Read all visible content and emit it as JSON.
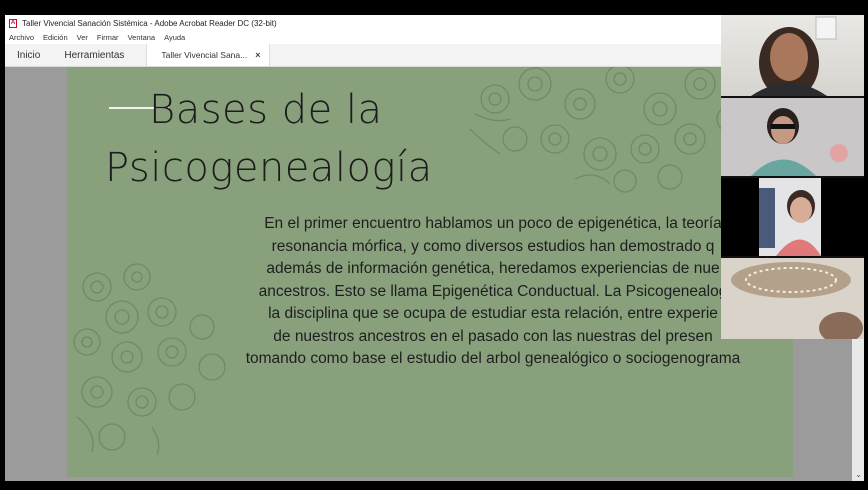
{
  "window": {
    "title": "Taller Vivencial Sanación Sistémica - Adobe Acrobat Reader DC (32-bit)"
  },
  "menu": [
    "Archivo",
    "Edición",
    "Ver",
    "Firmar",
    "Ventana",
    "Ayuda"
  ],
  "tabs": {
    "home": "Inicio",
    "tools": "Herramientas",
    "document": "Taller Vivencial Sana...",
    "close": "×"
  },
  "slide": {
    "title_line1": "Bases de la",
    "title_line2": "Psicogenealogía",
    "body_lines": [
      "En el primer encuentro hablamos un poco de epigenética, la teoría",
      "resonancia mórfica, y como diversos estudios han demostrado q",
      "además de información genética, heredamos experiencias de nue",
      "ancestros. Esto se llama Epigenética Conductual. La Psicogenealog",
      "la disciplina que se ocupa de estudiar esta relación, entre experie",
      "de nuestros ancestros en el pasado con las nuestras del presen",
      "tomando como base el estudio del arbol genealógico o sociogenograma"
    ],
    "background_color": "#88a17c"
  },
  "participants": [
    "participant-1",
    "participant-2",
    "participant-3",
    "participant-4"
  ],
  "scroll_arrow": "⌄"
}
